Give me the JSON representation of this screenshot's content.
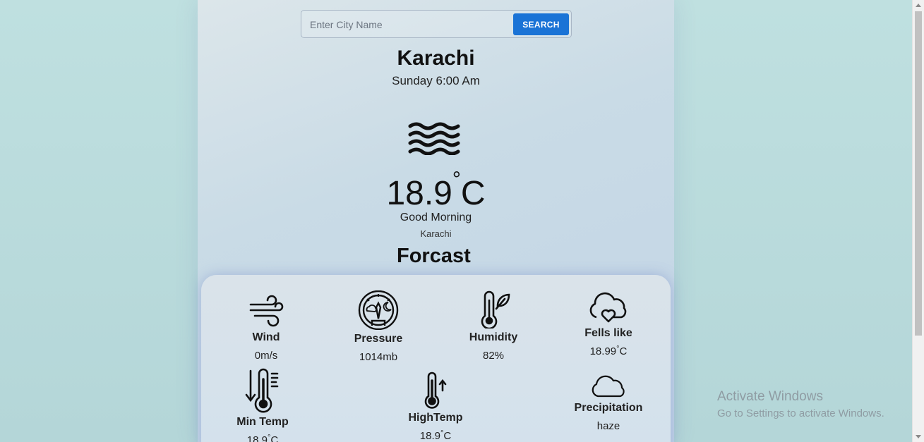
{
  "search": {
    "placeholder": "Enter City Name",
    "button_label": "SEARCH"
  },
  "weather": {
    "city": "Karachi",
    "datetime": "Sunday 6:00 Am",
    "icon": "haze-icon",
    "temperature_value": "18.9",
    "temperature_degree": "°",
    "temperature_unit": "C",
    "greeting": "Good Morning",
    "subcity": "Karachi"
  },
  "forecast": {
    "title": "Forcast",
    "stats": [
      {
        "label": "Wind",
        "value": "0m/s",
        "icon": "wind-icon"
      },
      {
        "label": "Pressure",
        "value": "1014mb",
        "icon": "pressure-gauge-icon"
      },
      {
        "label": "Humidity",
        "value": "82%",
        "icon": "thermometer-leaf-icon"
      },
      {
        "label": "Fells like",
        "value": "18.99",
        "value_unit": "C",
        "icon": "cloud-heart-icon"
      },
      {
        "label": "Min Temp",
        "value": "18.9",
        "value_unit": "C",
        "icon": "thermometer-down-icon"
      },
      {
        "label": "HighTemp",
        "value": "18.9",
        "value_unit": "C",
        "icon": "thermometer-up-icon"
      },
      {
        "label": "Precipitation",
        "value": "haze",
        "icon": "cloud-icon"
      }
    ]
  },
  "os_overlay": {
    "activate_title": "Activate Windows",
    "activate_subtitle": "Go to Settings to activate Windows."
  },
  "colors": {
    "accent": "#1a73d6",
    "page_background": "#bcdcdd"
  }
}
